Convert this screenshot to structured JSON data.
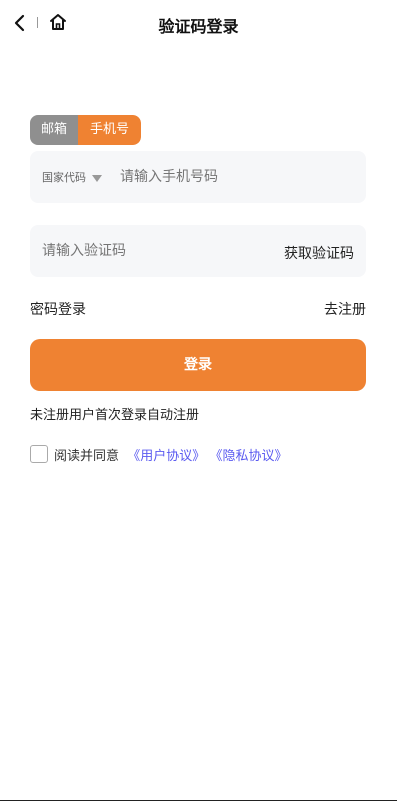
{
  "header": {
    "title": "验证码登录",
    "back_icon": "back-arrow-icon",
    "home_icon": "home-icon"
  },
  "login_type": {
    "email_label": "邮箱",
    "phone_label": "手机号",
    "selected": "手机号"
  },
  "phone_field": {
    "country_code_label": "国家代码",
    "placeholder": "请输入手机号码",
    "value": ""
  },
  "code_field": {
    "placeholder": "请输入验证码",
    "value": "",
    "get_code_label": "获取验证码"
  },
  "links": {
    "password_login": "密码登录",
    "register": "去注册"
  },
  "login_button": "登录",
  "notice": "未注册用户首次登录自动注册",
  "agreement": {
    "checked": false,
    "prefix": "阅读并同意",
    "user_agreement": "《用户协议》",
    "privacy_agreement": "《隐私协议》"
  },
  "colors": {
    "accent": "#ef8232",
    "tab_inactive": "#8f8f8f",
    "link": "#5a5af0",
    "field_bg": "#f6f7f9"
  }
}
